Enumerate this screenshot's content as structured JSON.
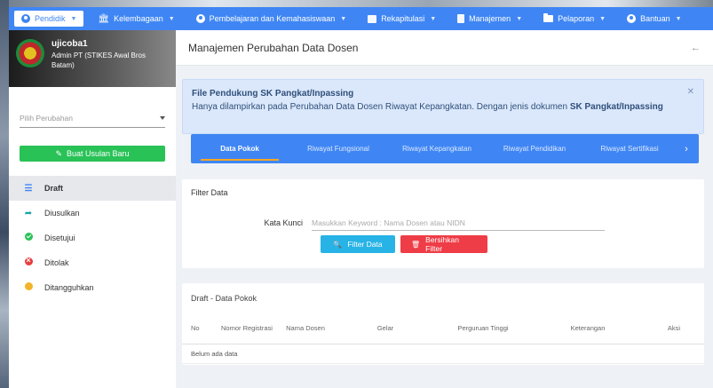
{
  "nav": {
    "items": [
      {
        "label": "Pendidik",
        "icon": "user-circle-icon",
        "active": true
      },
      {
        "label": "Kelembagaan",
        "icon": "institution-icon"
      },
      {
        "label": "Pembelajaran dan Kemahasiswaan",
        "icon": "user-circle-icon"
      },
      {
        "label": "Rekapitulasi",
        "icon": "chart-icon"
      },
      {
        "label": "Manajemen",
        "icon": "document-icon"
      },
      {
        "label": "Pelaporan",
        "icon": "folder-icon"
      },
      {
        "label": "Bantuan",
        "icon": "user-circle-icon"
      }
    ]
  },
  "profile": {
    "name": "ujicoba1",
    "role": "Admin PT (STIKES Awal Bros Batam)"
  },
  "sidebar": {
    "select_placeholder": "Pilih Perubahan",
    "new_button": "Buat Usulan Baru",
    "items": [
      {
        "label": "Draft",
        "icon": "list-icon"
      },
      {
        "label": "Diusulkan",
        "icon": "send-icon"
      },
      {
        "label": "Disetujui",
        "icon": "check-circle-icon"
      },
      {
        "label": "Ditolak",
        "icon": "x-circle-icon"
      },
      {
        "label": "Ditangguhkan",
        "icon": "pause-circle-icon"
      }
    ]
  },
  "header": {
    "title": "Manajemen Perubahan Data Dosen"
  },
  "alert": {
    "title": "File Pendukung SK Pangkat/Inpassing",
    "body_prefix": "Hanya dilampirkan pada Perubahan Data Dosen Riwayat Kepangkatan. Dengan jenis dokumen ",
    "body_bold": "SK Pangkat/Inpassing"
  },
  "tabs": [
    {
      "label": "Data Pokok",
      "active": true
    },
    {
      "label": "Riwayat Fungsional"
    },
    {
      "label": "Riwayat Kepangkatan"
    },
    {
      "label": "Riwayat Pendidikan"
    },
    {
      "label": "Riwayat Sertifikasi"
    }
  ],
  "filter": {
    "title": "Filter Data",
    "keyword_label": "Kata Kunci",
    "keyword_placeholder": "Masukkan Keyword : Nama Dosen atau NIDN",
    "filter_button": "Filter Data",
    "clear_button": "Bersihkan Filter"
  },
  "table": {
    "title": "Draft - Data Pokok",
    "columns": [
      "No",
      "Nomor Registrasi",
      "Nama Dosen",
      "Gelar",
      "Perguruan Tinggi",
      "Keterangan",
      "Aksi"
    ],
    "empty_text": "Belum ada data"
  },
  "colors": {
    "primary": "#3f86f4",
    "success": "#29c257",
    "danger": "#ef3d47",
    "info": "#27b3e6",
    "warning": "#f2b52a"
  }
}
